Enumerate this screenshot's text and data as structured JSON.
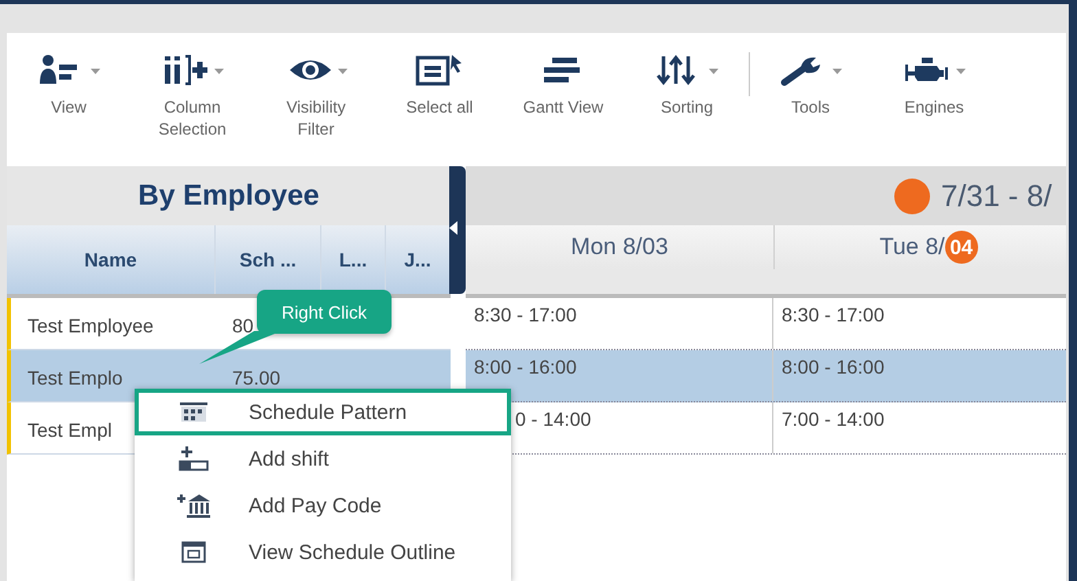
{
  "toolbar": [
    {
      "label": "View",
      "dropdown": true,
      "divider_before": false
    },
    {
      "label": "Column Selection",
      "dropdown": true,
      "divider_before": false
    },
    {
      "label": "Visibility Filter",
      "dropdown": true,
      "divider_before": false
    },
    {
      "label": "Select all",
      "dropdown": false,
      "divider_before": false
    },
    {
      "label": "Gantt View",
      "dropdown": false,
      "divider_before": false
    },
    {
      "label": "Sorting",
      "dropdown": true,
      "divider_before": false
    },
    {
      "label": "Tools",
      "dropdown": true,
      "divider_before": true
    },
    {
      "label": "Engines",
      "dropdown": true,
      "divider_before": false
    }
  ],
  "panel": {
    "title": "By Employee",
    "columns": [
      "Name",
      "Sch ...",
      "L...",
      "J..."
    ]
  },
  "schedule": {
    "range": "7/31 - 8/",
    "days": [
      {
        "label": "Mon 8/03"
      },
      {
        "label": "Tue 8/",
        "badge": "04"
      }
    ]
  },
  "rows": [
    {
      "name": "Test Employee",
      "cells": [
        "80"
      ],
      "shifts": [
        "8:30 - 17:00",
        "8:30 - 17:00"
      ],
      "selected": false,
      "covered": false
    },
    {
      "name": "Test Emplo",
      "cells": [
        "75.00"
      ],
      "shifts": [
        "8:00 - 16:00",
        "8:00 - 16:00"
      ],
      "selected": true,
      "covered": false
    },
    {
      "name": "Test Empl",
      "cells": [],
      "shifts": [
        "0 - 14:00",
        "7:00 - 14:00"
      ],
      "selected": false,
      "covered": true
    }
  ],
  "tooltip": "Right Click",
  "context_menu": [
    {
      "label": "Schedule Pattern",
      "selected": true
    },
    {
      "label": "Add shift",
      "selected": false
    },
    {
      "label": "Add Pay Code",
      "selected": false
    },
    {
      "label": "View Schedule Outline",
      "selected": false
    }
  ]
}
